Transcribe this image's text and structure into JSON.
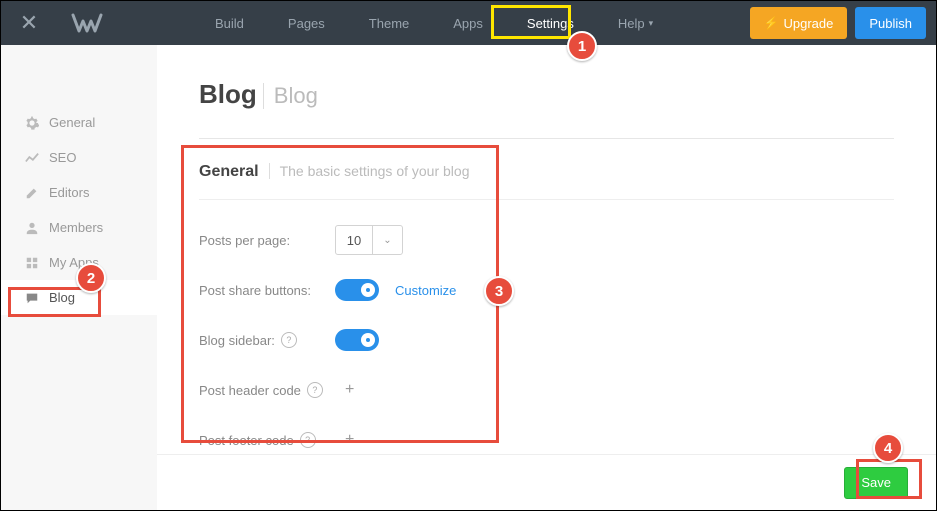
{
  "topnav": {
    "items": [
      "Build",
      "Pages",
      "Theme",
      "Apps",
      "Settings",
      "Help"
    ],
    "upgrade": "Upgrade",
    "publish": "Publish"
  },
  "sidebar": {
    "items": [
      {
        "label": "General"
      },
      {
        "label": "SEO"
      },
      {
        "label": "Editors"
      },
      {
        "label": "Members"
      },
      {
        "label": "My Apps"
      },
      {
        "label": "Blog"
      }
    ]
  },
  "page": {
    "title": "Blog",
    "subtitle": "Blog"
  },
  "section": {
    "title": "General",
    "subtitle": "The basic settings of your blog",
    "fields": {
      "posts_per_page_label": "Posts per page:",
      "posts_per_page_value": "10",
      "share_buttons_label": "Post share buttons:",
      "customize": "Customize",
      "blog_sidebar_label": "Blog sidebar:",
      "header_code_label": "Post header code",
      "footer_code_label": "Post footer code"
    }
  },
  "save": "Save",
  "callouts": {
    "c1": "1",
    "c2": "2",
    "c3": "3",
    "c4": "4"
  }
}
